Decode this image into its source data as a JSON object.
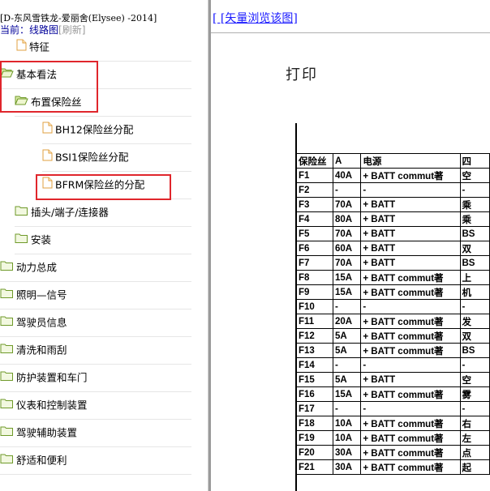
{
  "tree": {
    "header_title": "[D-东风雪铁龙-爱丽舍(Elysee)   -2014]",
    "current_label": "当前：线路图",
    "refresh_label": "[刷新]",
    "nodes": [
      {
        "label": "特征",
        "icon": "page-icon",
        "level": 2
      },
      {
        "label": "基本看法",
        "icon": "open-folder-icon",
        "level": 0
      },
      {
        "label": "布置保险丝",
        "icon": "open-folder-icon",
        "level": 1
      },
      {
        "label": "BH12保险丝分配",
        "icon": "page-icon",
        "level": 3
      },
      {
        "label": "BSI1保险丝分配",
        "icon": "page-icon",
        "level": 3
      },
      {
        "label": "BFRM保险丝的分配",
        "icon": "page-icon",
        "level": 3
      },
      {
        "label": "插头/端子/连接器",
        "icon": "folder-icon",
        "level": 1
      },
      {
        "label": "安装",
        "icon": "folder-icon",
        "level": 1
      },
      {
        "label": "动力总成",
        "icon": "folder-icon",
        "level": 0
      },
      {
        "label": "照明—信号",
        "icon": "folder-icon",
        "level": 0
      },
      {
        "label": "驾驶员信息",
        "icon": "folder-icon",
        "level": 0
      },
      {
        "label": "清洗和雨刮",
        "icon": "folder-icon",
        "level": 0
      },
      {
        "label": "防护装置和车门",
        "icon": "folder-icon",
        "level": 0
      },
      {
        "label": "仪表和控制装置",
        "icon": "folder-icon",
        "level": 0
      },
      {
        "label": "驾驶辅助装置",
        "icon": "folder-icon",
        "level": 0
      },
      {
        "label": "舒适和便利",
        "icon": "folder-icon",
        "level": 0
      }
    ],
    "highlight_color": "#e0262c"
  },
  "doc": {
    "vector_link": "[ [矢量浏览该图]",
    "print_label": "打印",
    "table": {
      "headers": [
        "保险丝",
        "A",
        "电源",
        "四"
      ],
      "rows": [
        [
          "F1",
          "40A",
          "+ BATT commut著",
          "空"
        ],
        [
          "F2",
          "-",
          "-",
          "-"
        ],
        [
          "F3",
          "70A",
          "+ BATT",
          "乘"
        ],
        [
          "F4",
          "80A",
          "+ BATT",
          "乘"
        ],
        [
          "F5",
          "70A",
          "+ BATT",
          "BS"
        ],
        [
          "F6",
          "60A",
          "+ BATT",
          "双"
        ],
        [
          "F7",
          "70A",
          "+ BATT",
          "BS"
        ],
        [
          "F8",
          "15A",
          "+ BATT commut著",
          "上"
        ],
        [
          "F9",
          "15A",
          "+ BATT commut著",
          "机"
        ],
        [
          "F10",
          "-",
          "-",
          "-"
        ],
        [
          "F11",
          "20A",
          "+ BATT commut著",
          "发"
        ],
        [
          "F12",
          "5A",
          "+ BATT commut著",
          "双"
        ],
        [
          "F13",
          "5A",
          "+ BATT commut著",
          "BS"
        ],
        [
          "F14",
          "-",
          "-",
          "-"
        ],
        [
          "F15",
          "5A",
          "+ BATT",
          "空"
        ],
        [
          "F16",
          "15A",
          "+ BATT commut著",
          "雾"
        ],
        [
          "F17",
          "-",
          "-",
          "-"
        ],
        [
          "F18",
          "10A",
          "+ BATT commut著",
          "右"
        ],
        [
          "F19",
          "10A",
          "+ BATT commut著",
          "左"
        ],
        [
          "F20",
          "30A",
          "+ BATT commut著",
          "点"
        ],
        [
          "F21",
          "30A",
          "+ BATT commut著",
          "起"
        ]
      ]
    }
  }
}
